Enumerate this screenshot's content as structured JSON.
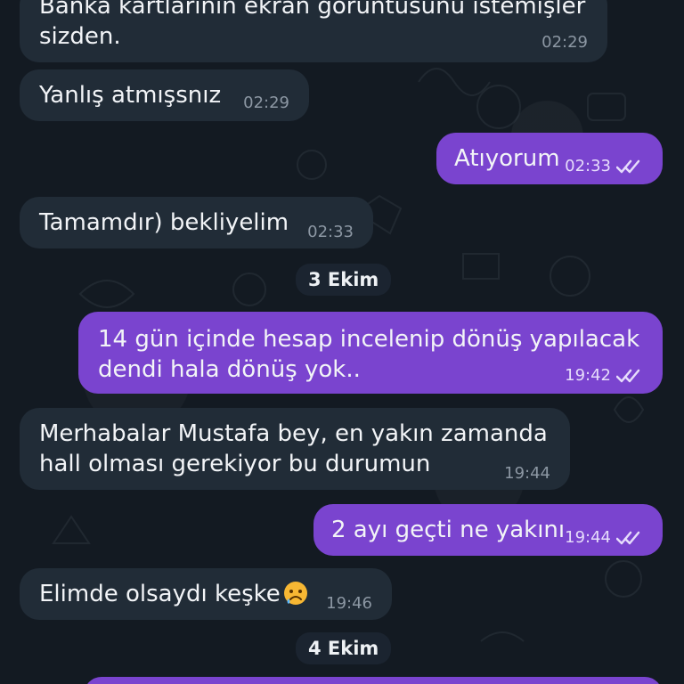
{
  "messages": [
    {
      "id": "m1",
      "direction": "incoming",
      "text": "Banka kartlarının ekran görüntüsünü istemişler\nsizden.",
      "time": "02:29"
    },
    {
      "id": "m2",
      "direction": "incoming",
      "text": "Yanlış atmışsnız",
      "time": "02:29"
    },
    {
      "id": "m3",
      "direction": "outgoing",
      "text": "Atıyorum",
      "time": "02:33",
      "status": "read"
    },
    {
      "id": "m4",
      "direction": "incoming",
      "text": "Tamamdır) bekliyelim",
      "time": "02:33"
    },
    {
      "id": "d1",
      "type": "date",
      "text": "3 Ekim"
    },
    {
      "id": "m5",
      "direction": "outgoing",
      "text": "14 gün içinde hesap incelenip dönüş yapılacak\ndendi hala dönüş yok..",
      "time": "19:42",
      "status": "read"
    },
    {
      "id": "m6",
      "direction": "incoming",
      "text": "Merhabalar Mustafa bey, en yakın zamanda\nhall olması gerekiyor bu durumun",
      "time": "19:44"
    },
    {
      "id": "m7",
      "direction": "outgoing",
      "text": "2 ayı geçti ne yakını",
      "time": "19:44",
      "status": "read"
    },
    {
      "id": "m8",
      "direction": "incoming",
      "text": "Elimde olsaydı keşke",
      "emoji": "sad-sweat-emoji",
      "time": "19:46"
    },
    {
      "id": "d2",
      "type": "date",
      "text": "4 Ekim"
    }
  ],
  "colors": {
    "background": "#131a22",
    "incoming_bubble": "#212c37",
    "outgoing_bubble": "#7a44cf",
    "text": "#f2f4f7",
    "timestamp": "#8c97a3"
  }
}
